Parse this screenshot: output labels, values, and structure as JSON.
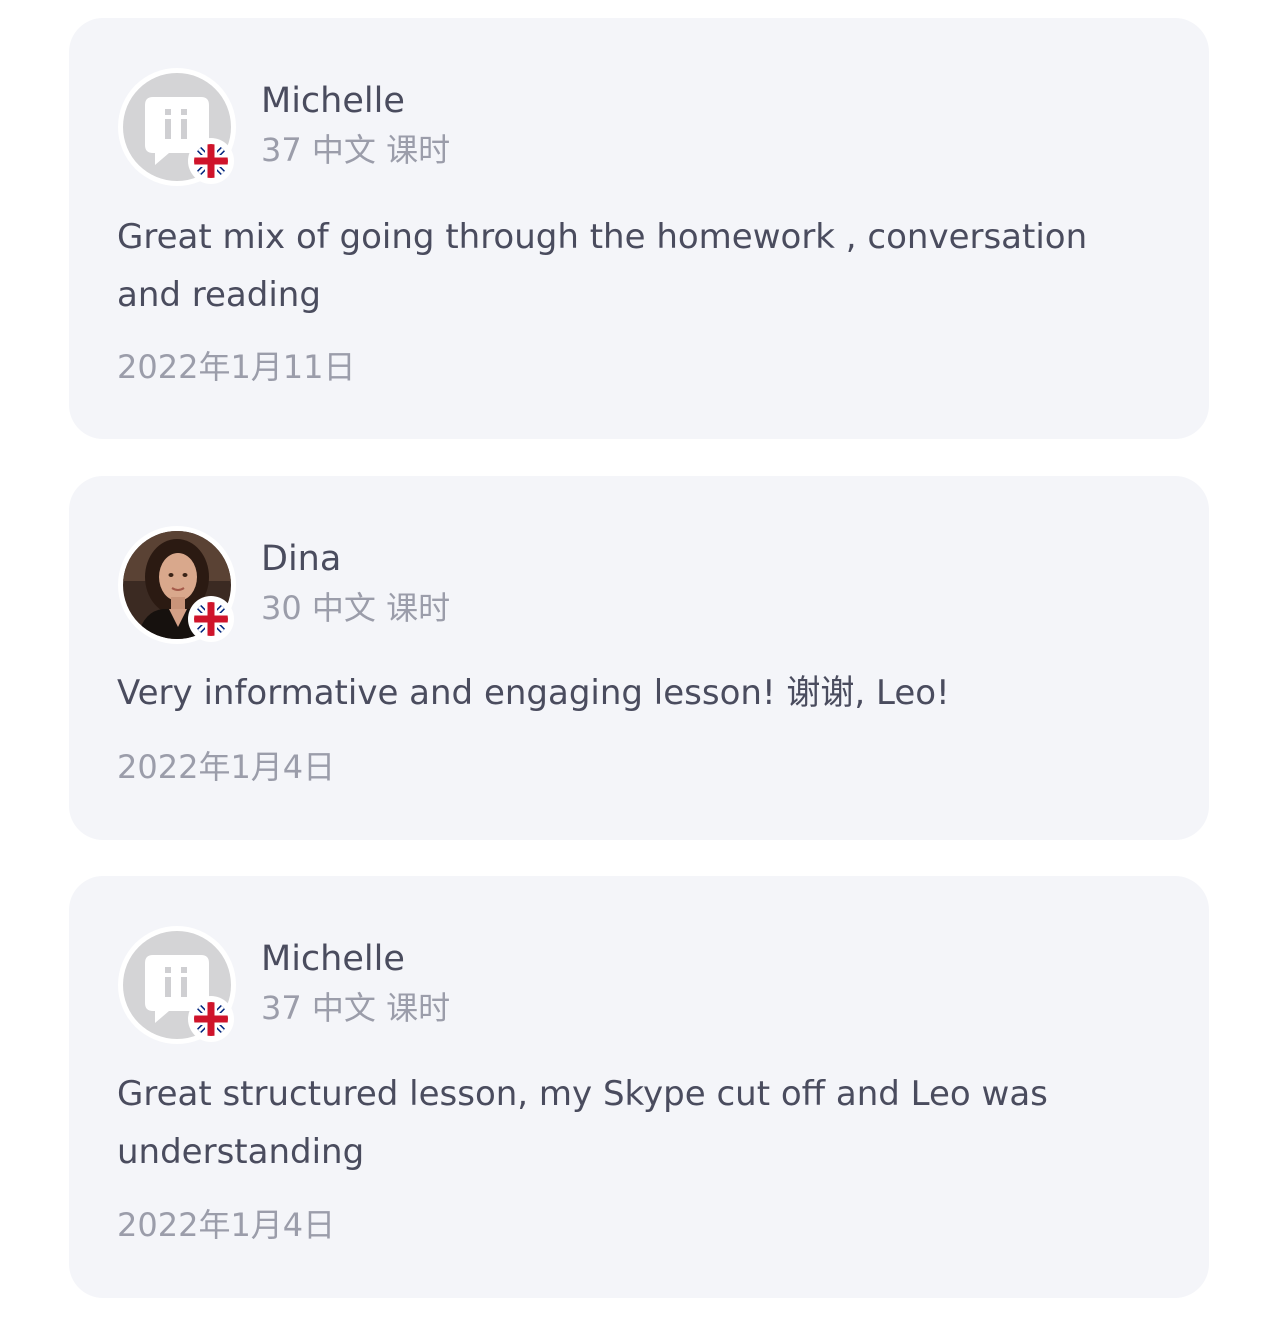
{
  "reviews": [
    {
      "avatar": "default-avatar-icon",
      "flag": "uk-flag-icon",
      "name": "Michelle",
      "lessons": "37 中文 课时",
      "text": "Great mix of going through the homework , conversation and reading",
      "date": "2022年1月11日"
    },
    {
      "avatar": "user-photo",
      "flag": "uk-flag-icon",
      "name": "Dina",
      "lessons": "30 中文 课时",
      "text": "Very informative and engaging lesson! 谢谢, Leo!",
      "date": "2022年1月4日"
    },
    {
      "avatar": "default-avatar-icon",
      "flag": "uk-flag-icon",
      "name": "Michelle",
      "lessons": "37 中文 课时",
      "text": "Great structured lesson, my Skype cut off and Leo was understanding",
      "date": "2022年1月4日"
    }
  ],
  "colors": {
    "card_bg": "#f4f5f9",
    "name": "#4a4c5e",
    "meta": "#9b9daa",
    "flag_red": "#cf142b",
    "flag_blue": "#00247d"
  }
}
